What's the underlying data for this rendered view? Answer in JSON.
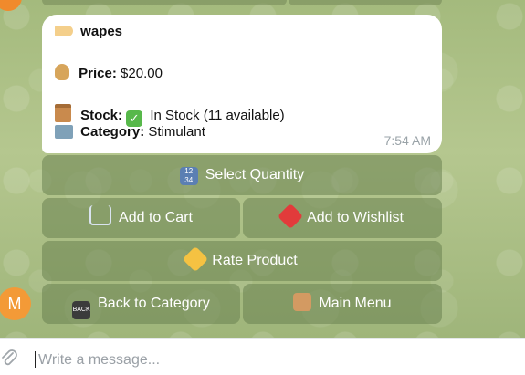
{
  "message": {
    "product_name": "wapes",
    "price_label": "Price:",
    "price_value": "$20.00",
    "stock_label": "Stock:",
    "stock_value": "In Stock (11 available)",
    "category_label": "Category:",
    "category_value": "Stimulant",
    "time": "7:54 AM"
  },
  "keyboard": {
    "select_quantity": "Select Quantity",
    "add_to_cart": "Add to Cart",
    "add_to_wishlist": "Add to Wishlist",
    "rate_product": "Rate Product",
    "back_to_category": "Back to Category",
    "main_menu": "Main Menu"
  },
  "avatar": {
    "initial": "M",
    "color": "#f39a37"
  },
  "composer": {
    "placeholder": "Write a message..."
  },
  "icons": {
    "tag": "price-tag-icon",
    "bag": "money-bag-icon",
    "box": "package-icon",
    "folder": "folder-icon",
    "check": "check-mark-icon",
    "quantity": "numbers-icon",
    "cart": "cart-icon",
    "heart": "heart-icon",
    "star": "star-icon",
    "back": "back-arrow-icon",
    "home": "home-icon",
    "attach": "paperclip-icon"
  }
}
